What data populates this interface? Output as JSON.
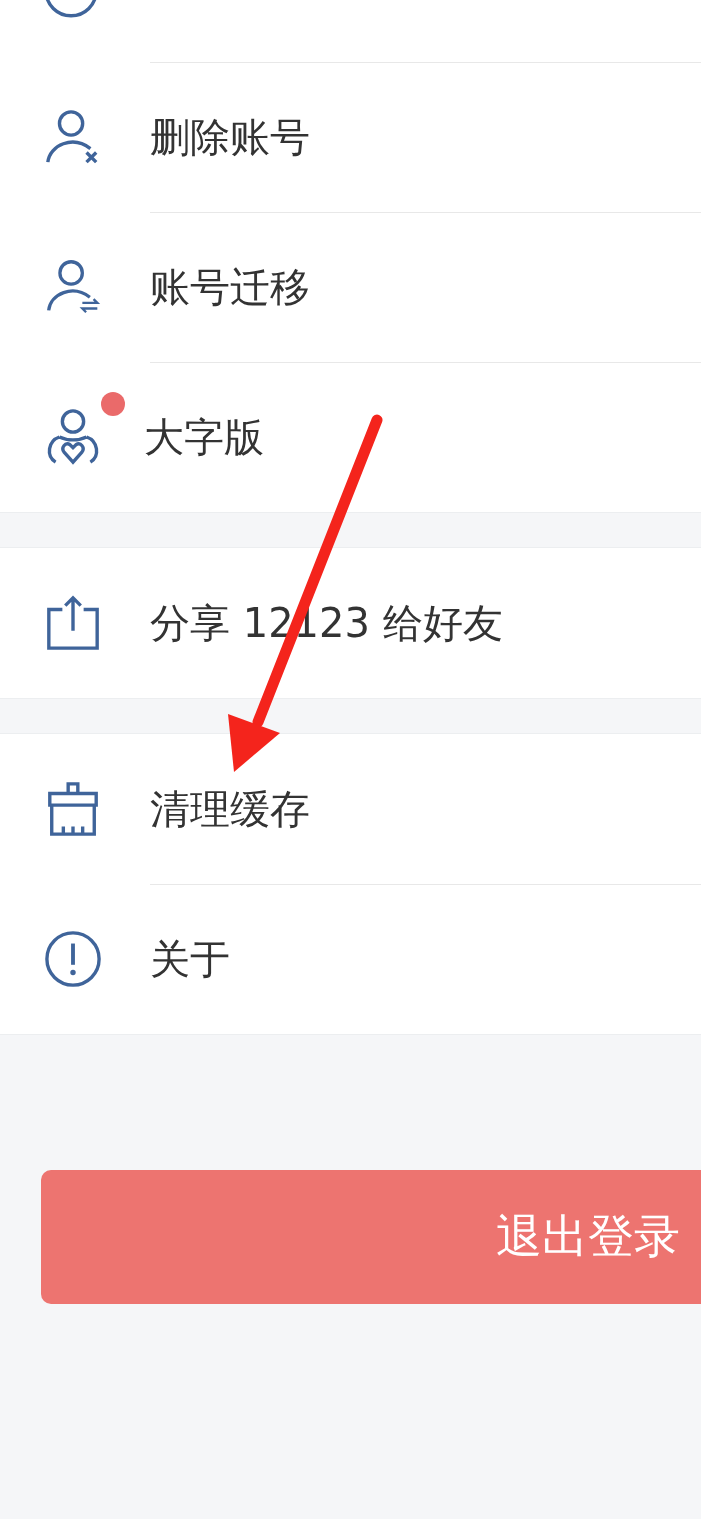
{
  "groups": [
    {
      "items": [
        {
          "kind": "partial",
          "badge": false
        },
        {
          "kind": "remove",
          "label": "删除账号",
          "badge": false
        },
        {
          "kind": "migrate",
          "label": "账号迁移",
          "badge": false
        },
        {
          "kind": "elder",
          "label": "大字版",
          "badge": true
        }
      ]
    },
    {
      "items": [
        {
          "kind": "share",
          "label": "分享 12123 给好友",
          "badge": false
        }
      ]
    },
    {
      "items": [
        {
          "kind": "clean",
          "label": "清理缓存",
          "badge": false
        },
        {
          "kind": "about",
          "label": "关于",
          "badge": false
        }
      ]
    }
  ],
  "logout_button": {
    "label": "退出登录"
  },
  "annotation": {
    "kind": "arrow"
  }
}
